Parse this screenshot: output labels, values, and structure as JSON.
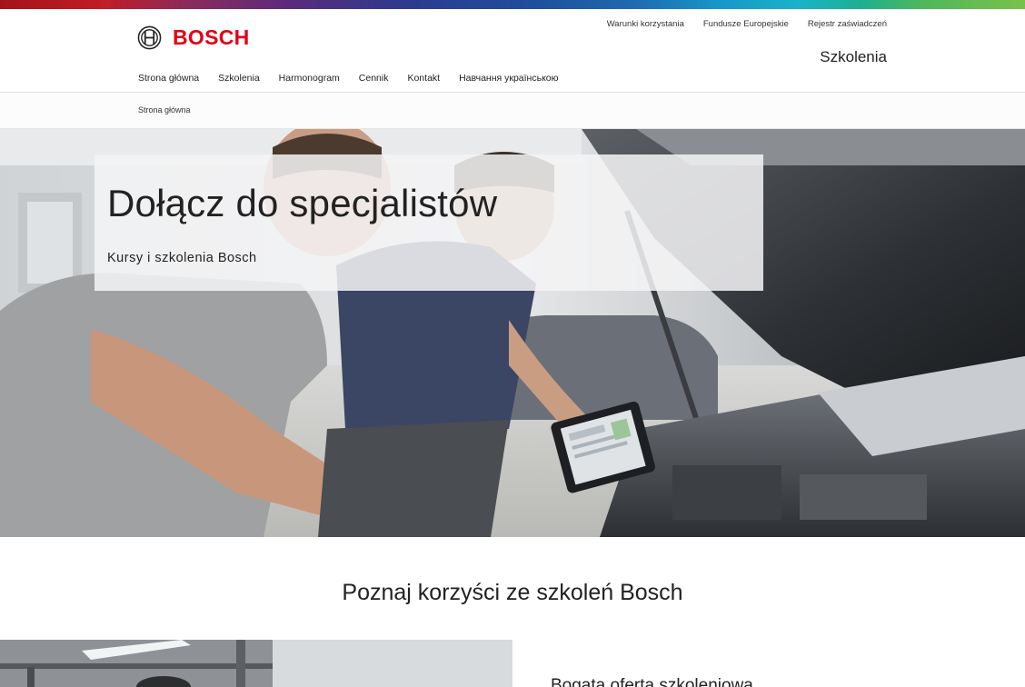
{
  "brand": {
    "name": "BOSCH",
    "accent_color": "#e20015",
    "logo_icon": "bosch-armature-icon"
  },
  "utility_links": [
    "Warunki korzystania",
    "Fundusze Europejskie",
    "Rejestr zaświadczeń"
  ],
  "site_title": "Szkolenia",
  "main_nav": [
    "Strona główna",
    "Szkolenia",
    "Harmonogram",
    "Cennik",
    "Kontakt",
    "Навчання українською"
  ],
  "breadcrumb": [
    "Strona główna"
  ],
  "hero": {
    "title": "Dołącz do specjalistów",
    "subtitle": "Kursy i szkolenia Bosch"
  },
  "benefits": {
    "heading": "Poznaj korzyści ze szkoleń Bosch",
    "first_feature_title": "Bogata oferta szkoleniowa"
  }
}
